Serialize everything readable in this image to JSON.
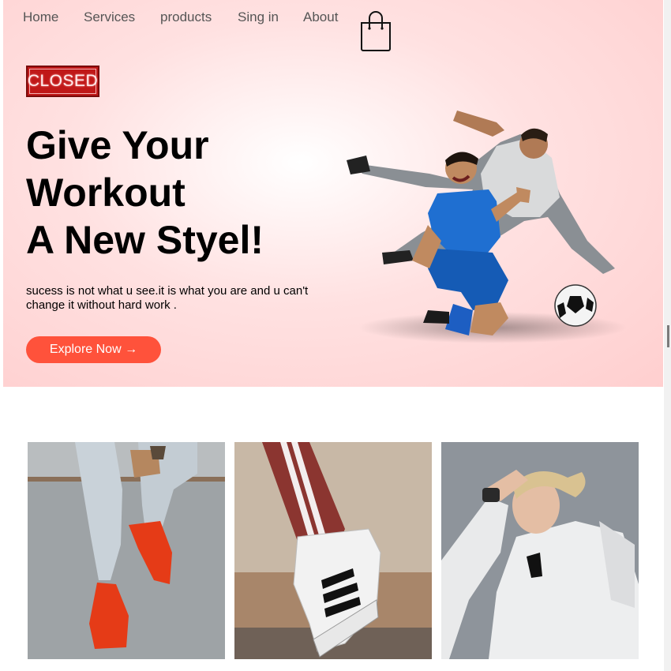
{
  "nav": {
    "items": [
      "Home",
      "Services",
      "products",
      "Sing in",
      "About"
    ]
  },
  "icons": {
    "cart": "shopping-bag-icon"
  },
  "badge": {
    "label": "CLOSED"
  },
  "hero": {
    "headline_lines": [
      "Give Your",
      "Workout",
      "A New Styel!"
    ],
    "subtext": "sucess is not what u see.it is what you are and u can't change it without hard work .",
    "cta_label": "Explore Now →"
  },
  "colors": {
    "accent": "#ff523b",
    "hero_bg": "#ffd6d6",
    "badge": "#c01818"
  }
}
